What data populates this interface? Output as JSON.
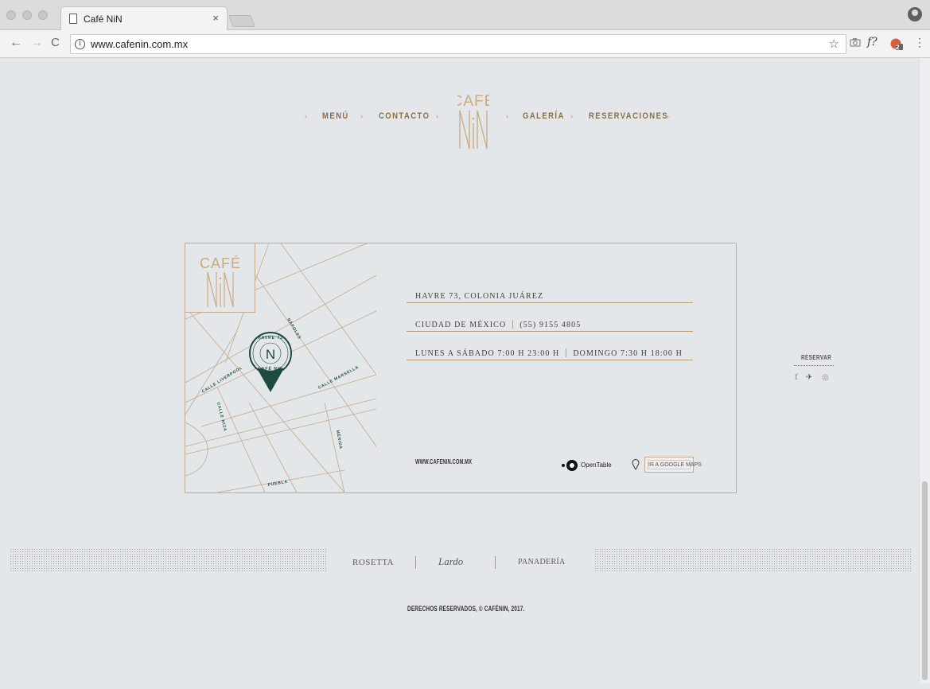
{
  "browser": {
    "tab_title": "Café NiN",
    "tab_close": "×",
    "url": "www.cafenin.com.mx",
    "info_icon": "i",
    "back": "←",
    "forward": "→",
    "reload": "C",
    "star": "☆",
    "ext_formula": "f?",
    "ext_badge": "2"
  },
  "logo": {
    "line1": "CAFÉ",
    "line2": "NiN"
  },
  "nav": {
    "arrow": "›",
    "items": [
      "MENÚ",
      "CONTACTO",
      "GALERÍA",
      "RESERVACIONES"
    ]
  },
  "contact": {
    "address": "HAVRE 73, COLONIA JUÁREZ",
    "city": "CIUDAD DE MÉXICO",
    "phone": "(55) 9155 4805",
    "hours_weekday": "LUNES A SÁBADO 7:00 H   23:00 H",
    "hours_sunday": "DOMINGO 7:30 H   18:00 H",
    "website": "WWW.CAFENIN.COM.MX",
    "opentable": "OpenTable",
    "maps_button": "IR A GOOGLE MAPS"
  },
  "map": {
    "streets": [
      "NÁPOLES",
      "CALLE LIVERPOOL",
      "CALLE MARSELLA",
      "CALLE NIZA",
      "MÉRIDA",
      "PUEBLA"
    ],
    "pin_ring_top": "HAVRE 73",
    "pin_ring_bottom": "CAFÉ NIN",
    "pin_letter": "N"
  },
  "sidebar": {
    "reservar": "RESERVAR",
    "social": [
      "f",
      "✈",
      "◎"
    ]
  },
  "footer": {
    "brands": [
      "ROSETTA",
      "Lardo",
      "PANADERÍA"
    ],
    "copyright": "DERECHOS RESERVADOS, © CAFÉNIN, 2017."
  },
  "colors": {
    "page_bg": "#e4e7ea",
    "gold": "#b59470",
    "pin_green": "#1f4a3f"
  }
}
